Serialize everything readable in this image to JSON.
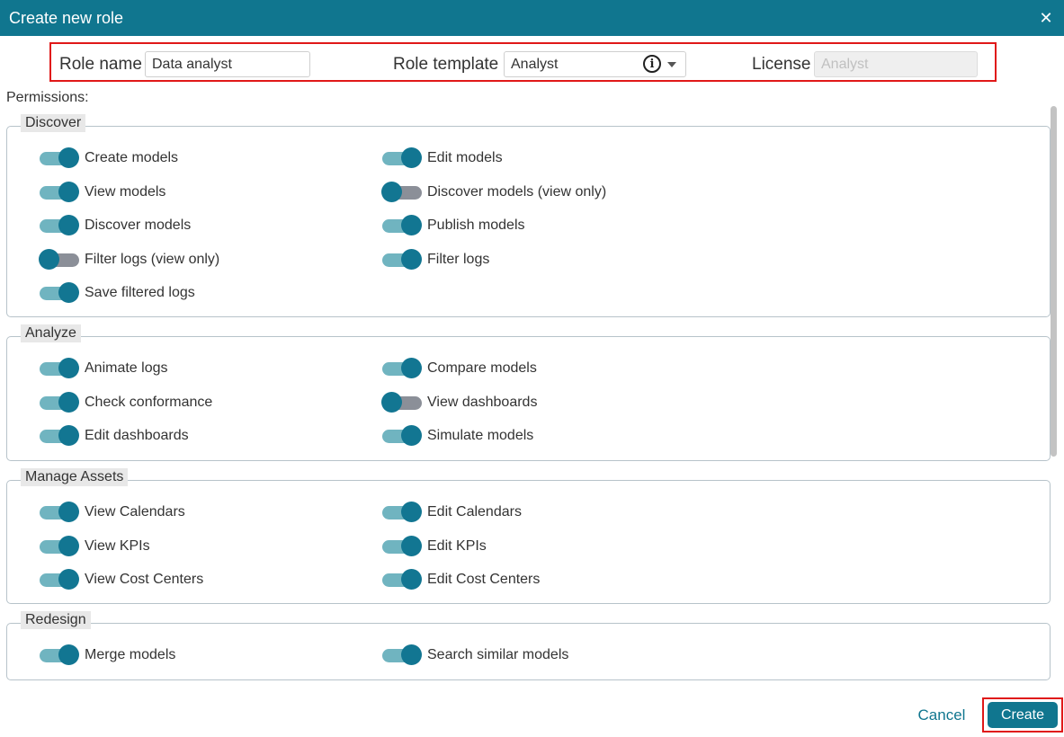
{
  "dialog": {
    "title": "Create new role",
    "close_icon": "close-icon"
  },
  "header": {
    "role_name_label": "Role name",
    "role_name_value": "Data analyst",
    "role_template_label": "Role template",
    "role_template_value": "Analyst",
    "license_label": "License",
    "license_value": "Analyst"
  },
  "permissions_label": "Permissions:",
  "sections": [
    {
      "name": "Discover",
      "items": [
        {
          "label": "Create models",
          "on": true
        },
        {
          "label": "Edit models",
          "on": true
        },
        {
          "label": "View models",
          "on": true
        },
        {
          "label": "Discover models (view only)",
          "on": false
        },
        {
          "label": "Discover models",
          "on": true
        },
        {
          "label": "Publish models",
          "on": true
        },
        {
          "label": "Filter logs (view only)",
          "on": false
        },
        {
          "label": "Filter logs",
          "on": true
        },
        {
          "label": "Save filtered logs",
          "on": true
        }
      ]
    },
    {
      "name": "Analyze",
      "items": [
        {
          "label": "Animate logs",
          "on": true
        },
        {
          "label": "Compare models",
          "on": true
        },
        {
          "label": "Check conformance",
          "on": true
        },
        {
          "label": "View dashboards",
          "on": false
        },
        {
          "label": "Edit dashboards",
          "on": true
        },
        {
          "label": "Simulate models",
          "on": true
        }
      ]
    },
    {
      "name": "Manage Assets",
      "items": [
        {
          "label": "View Calendars",
          "on": true
        },
        {
          "label": "Edit Calendars",
          "on": true
        },
        {
          "label": "View KPIs",
          "on": true
        },
        {
          "label": "Edit KPIs",
          "on": true
        },
        {
          "label": "View Cost Centers",
          "on": true
        },
        {
          "label": "Edit Cost Centers",
          "on": true
        }
      ]
    },
    {
      "name": "Redesign",
      "items": [
        {
          "label": "Merge models",
          "on": true
        },
        {
          "label": "Search similar models",
          "on": true
        }
      ]
    }
  ],
  "footer": {
    "cancel_label": "Cancel",
    "create_label": "Create"
  },
  "colors": {
    "accent": "#10768f",
    "toggle_on_track": "#70b4c0",
    "toggle_off_track": "#8b8f98",
    "highlight": "#e01818"
  }
}
